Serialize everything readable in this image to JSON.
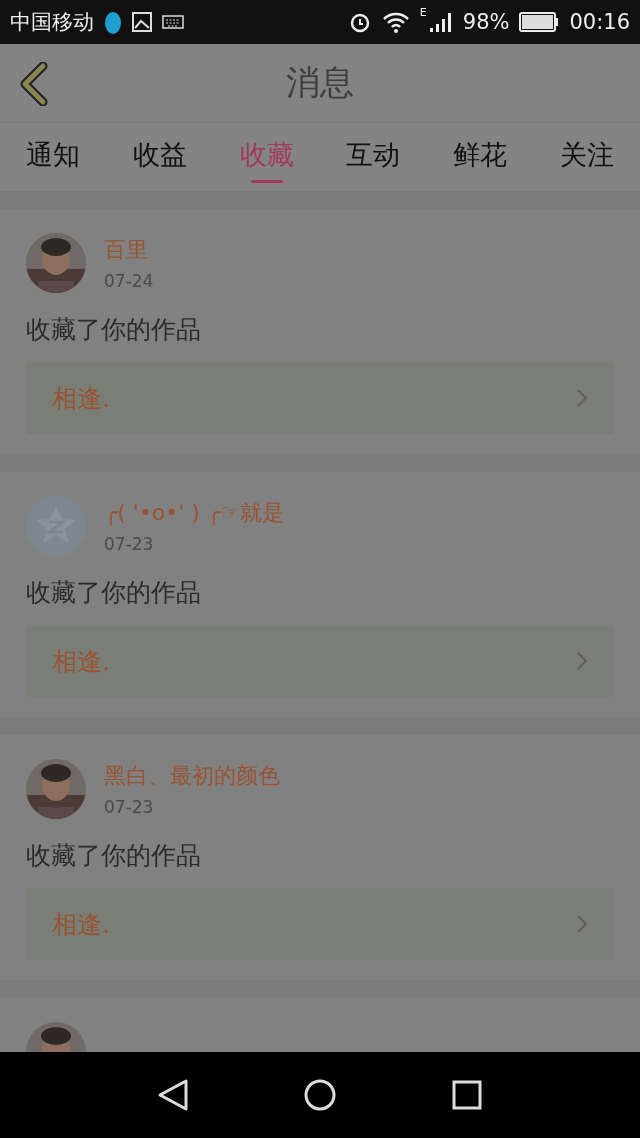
{
  "status_bar": {
    "carrier": "中国移动",
    "network": "E",
    "battery": "98%",
    "time": "00:16"
  },
  "header": {
    "title": "消息"
  },
  "tabs": [
    {
      "label": "通知",
      "selected": false
    },
    {
      "label": "收益",
      "selected": false
    },
    {
      "label": "收藏",
      "selected": true
    },
    {
      "label": "互动",
      "selected": false
    },
    {
      "label": "鲜花",
      "selected": false
    },
    {
      "label": "关注",
      "selected": false
    }
  ],
  "messages": [
    {
      "user": "百里",
      "avatar": {
        "kind": "picture"
      },
      "date": "07-24",
      "action": "收藏了你的作品",
      "work": "相逢."
    },
    {
      "user": "╭( '•o•' ) ╭☞就是",
      "avatar": {
        "kind": "default"
      },
      "date": "07-23",
      "action": "收藏了你的作品",
      "work": "相逢."
    },
    {
      "user": "黑白、最初的颜色",
      "avatar": {
        "kind": "picture"
      },
      "date": "07-23",
      "action": "收藏了你的作品",
      "work": "相逢."
    },
    {
      "avatar": {
        "kind": "picture"
      }
    }
  ]
}
